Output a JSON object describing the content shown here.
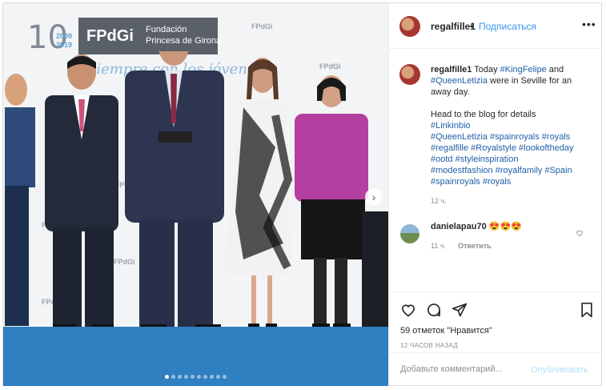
{
  "post": {
    "username": "regalfille1",
    "follow_label": "Подписаться",
    "separator": "•",
    "more_icon": "ellipsis-icon",
    "caption_user": "regalfille1",
    "caption_l1": " Today ",
    "caption_tag_king": "#KingFelipe",
    "caption_and": " and",
    "caption_tag_queen": "#QueenLetizia",
    "caption_l2": " were in Seville for an away day.",
    "caption_l3": "Head to the blog for details",
    "hashtags": [
      "#Linkinbio",
      "#QueenLetizia #spainroyals #royals",
      "#regalfille #Royalstyle #lookoftheday",
      "#ootd #styleinspiration",
      "#modestfashion #royalfamily #Spain",
      "#spainroyals #royals"
    ],
    "caption_time": "12 ч."
  },
  "comment": {
    "username": "danielapau70",
    "text": " 😍😍😍",
    "time": "11 ч.",
    "reply_label": "Ответить"
  },
  "actions": {
    "likes": "59 отметок \"Нравится\"",
    "posted": "12 ЧАСОВ НАЗАД",
    "comment_placeholder": "Добавьте комментарий...",
    "publish_label": "Опубликовать"
  },
  "photo": {
    "banner_text": "FPdGi",
    "banner_sub_1": "Fundación",
    "banner_sub_2": "Princesa de Girona",
    "anniversary": "10",
    "years": "2009\n2019",
    "tagline": "Siempre con los jóvenes",
    "wall_logo": "FPdGi",
    "carousel_count": 10,
    "carousel_active": 1
  },
  "colors": {
    "link": "#3897f0",
    "hashtag": "#1f5fa7",
    "stage": "#2f7fc1"
  }
}
